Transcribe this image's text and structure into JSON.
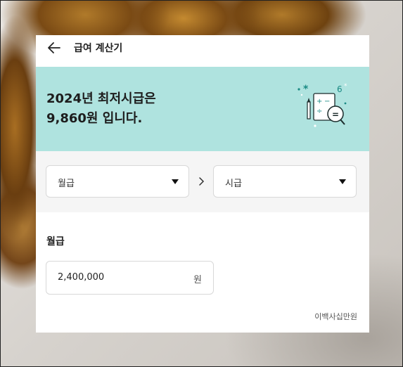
{
  "header": {
    "title": "급여 계산기",
    "back_icon": "arrow-left-icon"
  },
  "banner": {
    "line1": "2024년 최저시급은",
    "line2": "9,860원 입니다.",
    "background": "#afe3df",
    "illustration_icon": "calculator-magnifier-icon"
  },
  "converter": {
    "from_label": "월급",
    "to_label": "시급",
    "separator_icon": "chevron-right-icon",
    "dropdown_icon": "caret-down-icon"
  },
  "input": {
    "label": "월급",
    "value": "2,400,000",
    "unit": "원",
    "reading": "이백사십만원"
  }
}
